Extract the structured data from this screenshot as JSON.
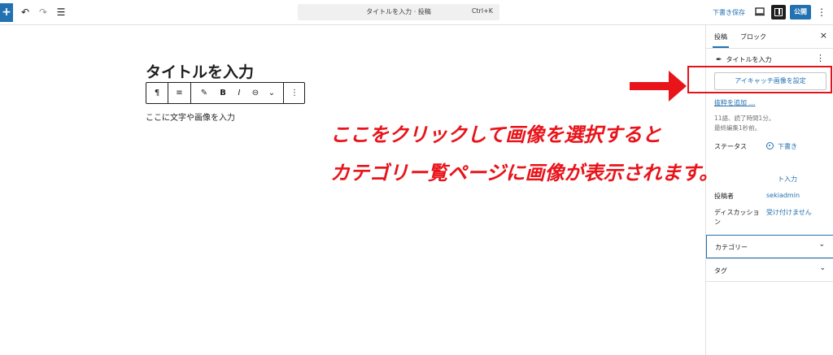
{
  "topbar": {
    "add_icon": "+",
    "undo_icon": "↶",
    "redo_icon": "↷",
    "list_view_icon": "☰",
    "command_title": "タイトルを入力 · 投稿",
    "command_shortcut": "Ctrl+K",
    "save_draft": "下書き保存",
    "publish": "公開",
    "more_icon": "⋮"
  },
  "editor": {
    "title": "タイトルを入力",
    "paragraph": "ここに文字や画像を入力",
    "toolbar": {
      "paragraph_icon": "¶",
      "align_icon": "≡",
      "highlighter_icon": "✎",
      "bold": "B",
      "italic": "I",
      "link_icon": "⊖",
      "chevron_icon": "⌄",
      "more_icon": "⋮"
    }
  },
  "annotation": {
    "line1": "ここをクリックして画像を選択すると",
    "line2": "カテゴリー覧ページに画像が表示されます。",
    "color": "#e8141a"
  },
  "sidebar": {
    "tab_post": "投稿",
    "tab_block": "ブロック",
    "close_icon": "×",
    "post_type_icon": "✒",
    "post_type": "タイトルを入力",
    "more_icon": "⋮",
    "featured_image_button": "アイキャッチ画像を設定",
    "excerpt_link": "抜粋を追加 …",
    "meta_words": "11語、読了時間1分。",
    "meta_edited": "最終編集1秒前。",
    "status_label": "ステータス",
    "status_value": "下書き",
    "link_value": "ト入力",
    "author_label": "投稿者",
    "author_value": "sekiadmin",
    "discussion_label": "ディスカッション",
    "discussion_value": "受け付けません",
    "category_panel": "カテゴリー",
    "tag_panel": "タグ",
    "chevron_icon": "⌄"
  },
  "colors": {
    "accent": "#2271b1",
    "highlight_border": "#e0141a"
  }
}
